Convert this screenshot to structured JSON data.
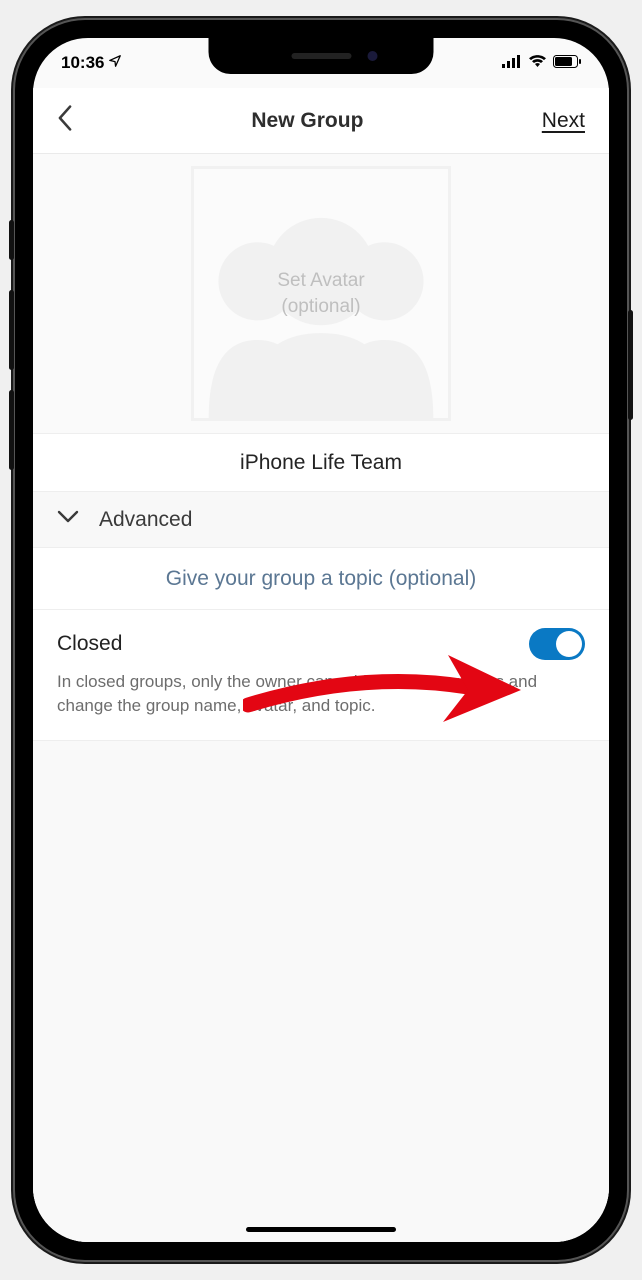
{
  "status": {
    "time": "10:36"
  },
  "nav": {
    "title": "New Group",
    "next": "Next"
  },
  "avatar": {
    "line1": "Set Avatar",
    "line2": "(optional)"
  },
  "group": {
    "name": "iPhone Life Team"
  },
  "advanced": {
    "label": "Advanced"
  },
  "topic": {
    "placeholder": "Give your group a topic (optional)"
  },
  "closed": {
    "label": "Closed",
    "enabled": true,
    "description": "In closed groups, only the owner can add/remove members and change the group name, avatar, and topic."
  },
  "colors": {
    "toggle_on": "#0a79c4",
    "arrow": "#e30613"
  }
}
